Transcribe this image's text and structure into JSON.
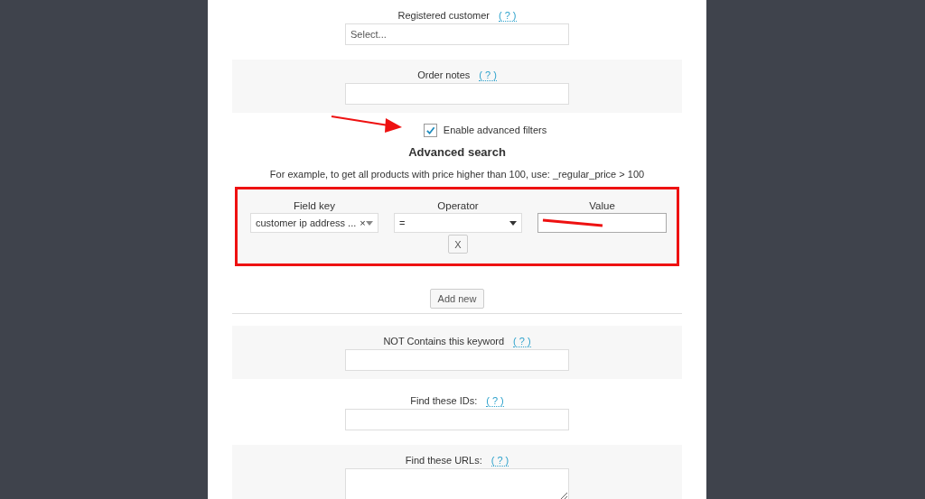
{
  "fields": [
    {
      "label": "Registered customer",
      "help": "( ? )",
      "kind": "select",
      "placeholder": "Select..."
    },
    {
      "label": "Order notes",
      "help": "( ? )",
      "kind": "text"
    }
  ],
  "advanced_toggle": {
    "label": "Enable advanced filters",
    "checked": true
  },
  "advanced": {
    "title": "Advanced search",
    "hint": "For example, to get all products with price higher than 100, use: _regular_price > 100",
    "columns": [
      "Field key",
      "Operator",
      "Value"
    ],
    "field_key": "customer ip address ...",
    "clear": "×",
    "operator": "=",
    "value_redacted": true,
    "remove": "X",
    "add": "Add new"
  },
  "more_fields": [
    {
      "label": "NOT Contains this keyword",
      "help": "( ? )",
      "kind": "text"
    },
    {
      "label": "Find these IDs:",
      "help": "( ? )",
      "kind": "text"
    },
    {
      "label": "Find these URLs:",
      "help": "( ? )",
      "kind": "textarea"
    }
  ]
}
